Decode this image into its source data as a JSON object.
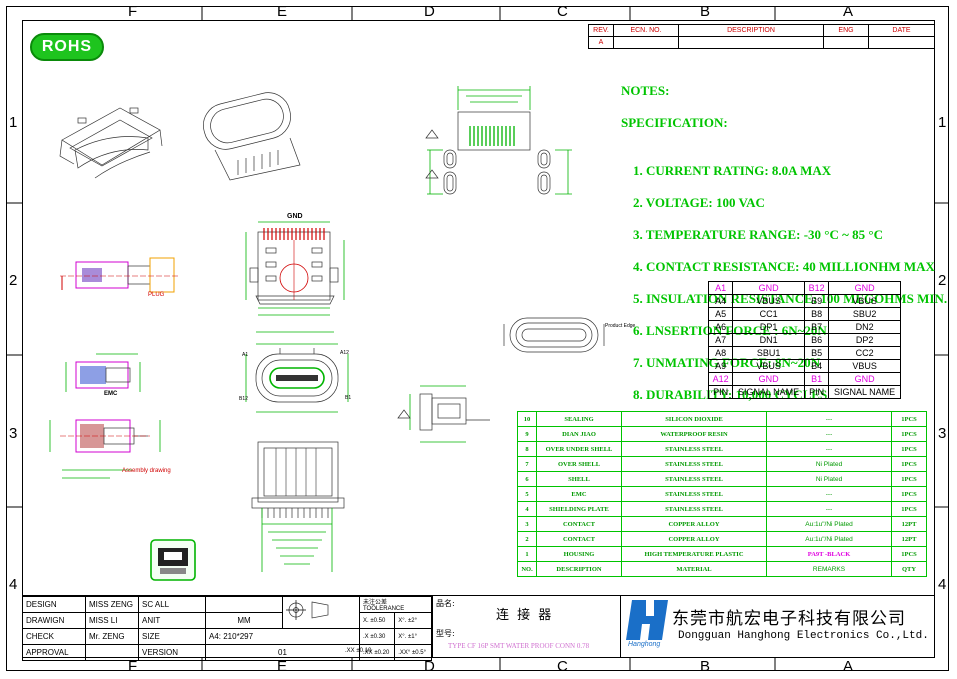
{
  "zones": {
    "columns": [
      "F",
      "E",
      "D",
      "C",
      "B",
      "A"
    ],
    "rows": [
      "1",
      "2",
      "3",
      "4"
    ]
  },
  "rohs": "ROHS",
  "revision_block": {
    "headers": [
      "REV.",
      "ECN. NO.",
      "DESCRIPTION",
      "ENG",
      "DATE"
    ],
    "row": [
      "A",
      "",
      "",
      "",
      ""
    ]
  },
  "notes": {
    "title": "NOTES:",
    "subtitle": "SPECIFICATION:",
    "items": [
      "1. CURRENT RATING: 8.0A MAX",
      "2. VOLTAGE: 100 VAC",
      "3. TEMPERATURE RANGE: -30 °C ~ 85 °C",
      "4. CONTACT RESISTANCE: 40 MILLIONHM MAX",
      "5. INSULATION RESISTANCE: 100 MEGOHMS MIN.",
      "6. LNSERTION FORCE : 6N~20N",
      "7. UNMATING FORCE: 8N~20N",
      "8. DURABILITY: 10,000 CYCLES"
    ]
  },
  "pin_table": {
    "rows": [
      [
        "A1",
        "GND",
        "B12",
        "GND"
      ],
      [
        "A4",
        "VBUS",
        "B9",
        "VBUS"
      ],
      [
        "A5",
        "CC1",
        "B8",
        "SBU2"
      ],
      [
        "A6",
        "DP1",
        "B7",
        "DN2"
      ],
      [
        "A7",
        "DN1",
        "B6",
        "DP2"
      ],
      [
        "A8",
        "SBU1",
        "B5",
        "CC2"
      ],
      [
        "A9",
        "VBUS",
        "B4",
        "VBUS"
      ],
      [
        "A12",
        "GND",
        "B1",
        "GND"
      ],
      [
        "PIN",
        "SIGNAL NAME",
        "PIN",
        "SIGNAL NAME"
      ]
    ]
  },
  "bom": {
    "rows": [
      [
        "10",
        "SEALING",
        "SILICON DIOXIDE",
        "---",
        "1PCS"
      ],
      [
        "9",
        "DIAN JIAO",
        "WATERPROOF RESIN",
        "---",
        "1PCS"
      ],
      [
        "8",
        "OVER UNDER SHELL",
        "STAINLESS STEEL",
        "---",
        "1PCS"
      ],
      [
        "7",
        "OVER SHELL",
        "STAINLESS STEEL",
        "Ni Plated",
        "1PCS"
      ],
      [
        "6",
        "SHELL",
        "STAINLESS STEEL",
        "Ni Plated",
        "1PCS"
      ],
      [
        "5",
        "EMC",
        "STAINLESS STEEL",
        "---",
        "1PCS"
      ],
      [
        "4",
        "SHIELDING PLATE",
        "STAINLESS STEEL",
        "---",
        "1PCS"
      ],
      [
        "3",
        "CONTACT",
        "COPPER ALLOY",
        "Au:1u\"/Ni Plated",
        "12PT"
      ],
      [
        "2",
        "CONTACT",
        "COPPER ALLOY",
        "Au:1u\"/Ni Plated",
        "12PT"
      ],
      [
        "1",
        "HOUSING",
        "HIGH TEMPERATURE PLASTIC",
        "PA9T -BLACK",
        "1PCS"
      ],
      [
        "NO.",
        "DESCRIPTION",
        "MATERIAL",
        "REMARKS",
        "QTY"
      ]
    ]
  },
  "title_block": {
    "design": "DESIGN",
    "design_by": "MISS ZENG",
    "scale": "SC ALL",
    "drawing": "DRAWIGN",
    "drawing_by": "MISS LI",
    "unit": "ANIT",
    "unit_value": "MM",
    "check": "CHECK",
    "check_by": "Mr. ZENG",
    "size": "SIZE",
    "size_value": "A4: 210*297",
    "approval": "APPROVAL",
    "version": "VERSION",
    "version_value": "01",
    "tol_title": "未注公差  TOOLERANCE",
    "tol": [
      "X. ±0.50",
      "X°. ±2°",
      ".X ±0.30",
      "X°. ±1°",
      ".XX ±0.20",
      ".XX° ±0.5°",
      ".XX ±0.10",
      ""
    ],
    "name_label": "品名:",
    "name_value": "连 接 器",
    "model_label": "型号:",
    "model_value": "TYPE CF 16P SMT WATER PROOF CONN 0.78",
    "company_cn": "东莞市航宏电子科技有限公司",
    "company_en": "Dongguan Hanghong Electronics Co.,Ltd.",
    "logo_text": "Hanghong"
  },
  "drawing_labels": {
    "gnd": "GND",
    "plug": "PLUG",
    "emc": "EMC",
    "assembly": "Assembly drawing",
    "a1": "A1",
    "a12": "A12",
    "b12": "B12",
    "b1": "B1",
    "product_edge": "Product Edge"
  },
  "colors": {
    "green": "#00b400",
    "magenta": "#e000e0",
    "red": "#cc0000"
  }
}
